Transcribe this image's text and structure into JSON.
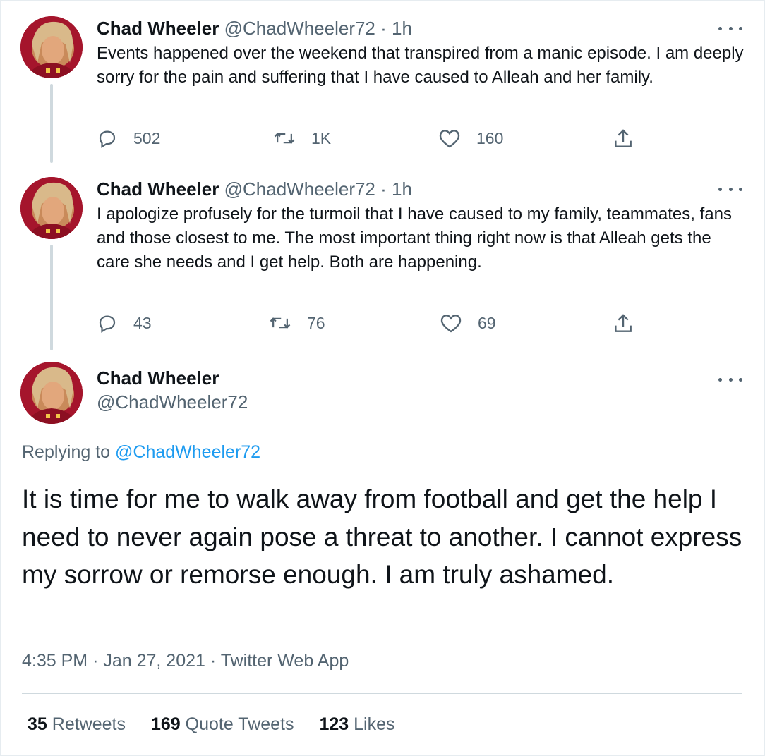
{
  "author": {
    "name": "Chad Wheeler",
    "handle": "@ChadWheeler72"
  },
  "thread": [
    {
      "time": "1h",
      "text": "Events happened over the weekend that transpired from a manic episode.  I am deeply sorry for the pain and suffering that I have caused to Alleah and her family.",
      "replies": "502",
      "retweets": "1K",
      "likes": "160"
    },
    {
      "time": "1h",
      "text": "I apologize profusely for the turmoil that I have caused to my family, teammates, fans and those closest to me. The most important thing right now is that Alleah gets the care she needs and I get help.  Both are happening.",
      "replies": "43",
      "retweets": "76",
      "likes": "69"
    }
  ],
  "main_tweet": {
    "replying_prefix": "Replying to",
    "replying_to": "@ChadWheeler72",
    "text": "It is time for me to walk away from football and get the help I need to never again pose a threat to another. I cannot express my sorrow or remorse enough. I am truly ashamed.",
    "time": "4:35 PM",
    "date": "Jan 27, 2021",
    "source": "Twitter Web App",
    "retweets_count": "35",
    "retweets_label": "Retweets",
    "quotes_count": "169",
    "quotes_label": "Quote Tweets",
    "likes_count": "123",
    "likes_label": "Likes"
  },
  "separator": "·",
  "colors": {
    "text": "#0f1419",
    "secondary": "#536471",
    "link": "#1d9bf0",
    "avatar_bg": "#a5152c"
  }
}
